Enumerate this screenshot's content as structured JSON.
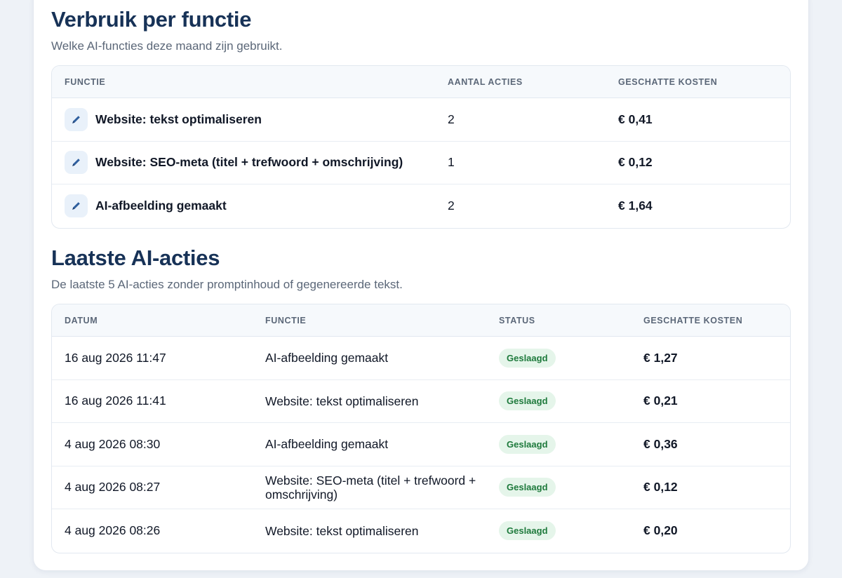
{
  "usage_section": {
    "title": "Verbruik per functie",
    "subtitle": "Welke AI-functies deze maand zijn gebruikt.",
    "columns": [
      "FUNCTIE",
      "AANTAL ACTIES",
      "GESCHATTE KOSTEN"
    ],
    "rows": [
      {
        "icon": "pencil-icon",
        "function": "Website: tekst optimaliseren",
        "count": "2",
        "cost": "€ 0,41"
      },
      {
        "icon": "pencil-icon",
        "function": "Website: SEO-meta (titel + trefwoord + omschrijving)",
        "count": "1",
        "cost": "€ 0,12"
      },
      {
        "icon": "pencil-icon",
        "function": "AI-afbeelding gemaakt",
        "count": "2",
        "cost": "€ 1,64"
      }
    ]
  },
  "recent_section": {
    "title": "Laatste AI-acties",
    "subtitle": "De laatste 5 AI-acties zonder promptinhoud of gegenereerde tekst.",
    "columns": [
      "DATUM",
      "FUNCTIE",
      "STATUS",
      "GESCHATTE KOSTEN"
    ],
    "rows": [
      {
        "date": "16 aug 2026 11:47",
        "function": "AI-afbeelding gemaakt",
        "status": "Geslaagd",
        "cost": "€ 1,27"
      },
      {
        "date": "16 aug 2026 11:41",
        "function": "Website: tekst optimaliseren",
        "status": "Geslaagd",
        "cost": "€ 0,21"
      },
      {
        "date": "4 aug 2026 08:30",
        "function": "AI-afbeelding gemaakt",
        "status": "Geslaagd",
        "cost": "€ 0,36"
      },
      {
        "date": "4 aug 2026 08:27",
        "function": "Website: SEO-meta (titel + trefwoord + omschrijving)",
        "status": "Geslaagd",
        "cost": "€ 0,12"
      },
      {
        "date": "4 aug 2026 08:26",
        "function": "Website: tekst optimaliseren",
        "status": "Geslaagd",
        "cost": "€ 0,20"
      }
    ]
  },
  "colors": {
    "title": "#173257",
    "badge_bg": "#e5f5ea",
    "badge_text": "#1e7a3c",
    "icon_bg": "#e9f1fa",
    "icon_fg": "#2f5f9e"
  }
}
